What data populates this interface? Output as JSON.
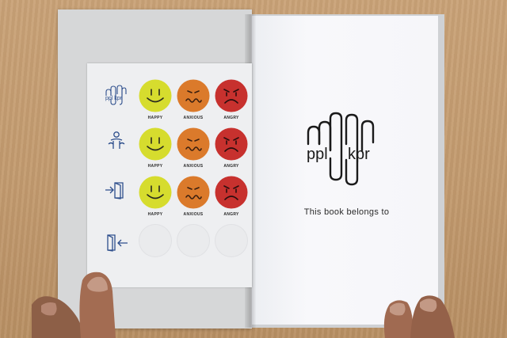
{
  "logo": {
    "text_left": "ppl",
    "text_right": "kpr"
  },
  "right_page": {
    "belongs_text": "This book belongs to"
  },
  "sticker_sheet": {
    "rows": [
      {
        "icon": "ppl-kpr-logo-icon",
        "labels": [
          "HAPPY",
          "ANXIOUS",
          "ANGRY"
        ]
      },
      {
        "icon": "person-icon",
        "labels": [
          "HAPPY",
          "ANXIOUS",
          "ANGRY"
        ]
      },
      {
        "icon": "enter-door-icon",
        "labels": [
          "HAPPY",
          "ANXIOUS",
          "ANGRY"
        ]
      },
      {
        "icon": "exit-door-icon",
        "labels": []
      }
    ],
    "colors": {
      "happy": "#d6dc2e",
      "anxious": "#db7a2b",
      "angry": "#c7312e"
    }
  },
  "background": {
    "surface": "wooden-table",
    "color": "#c79f73"
  }
}
